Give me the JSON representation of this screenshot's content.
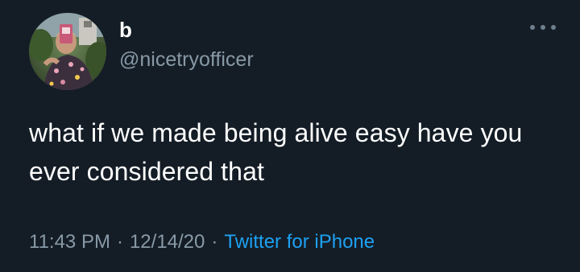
{
  "tweet": {
    "author": {
      "display_name": "b",
      "handle": "@nicetryofficer"
    },
    "text": "what if we made being alive easy have you ever considered that",
    "meta": {
      "time": "11:43 PM",
      "date": "12/14/20",
      "separator": "·",
      "source": "Twitter for iPhone"
    },
    "more_icon": "more-horizontal-icon"
  },
  "colors": {
    "background": "#141d26",
    "primary_text": "#ffffff",
    "secondary_text": "#8899a6",
    "link": "#1da1f2"
  }
}
